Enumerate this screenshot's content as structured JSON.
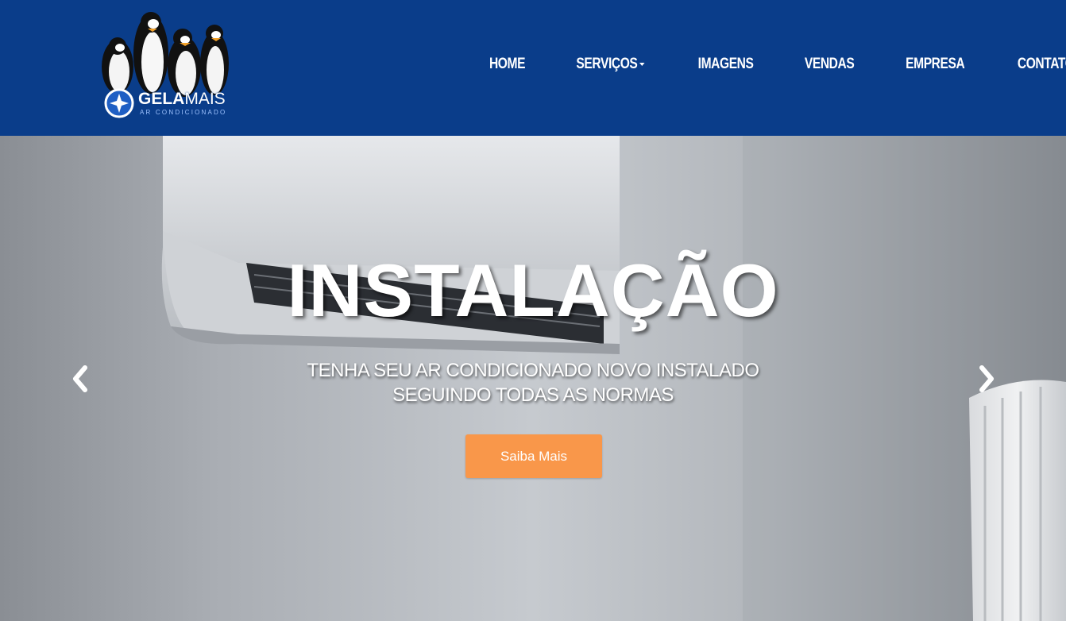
{
  "brand": {
    "name_bold": "GELA",
    "name_light": "MAIS",
    "tagline": "AR CONDICIONADO",
    "logo_icon": "penguins-logo-icon"
  },
  "nav": {
    "items": [
      {
        "label": "HOME",
        "dropdown": false
      },
      {
        "label": "SERVIÇOS",
        "dropdown": true
      },
      {
        "label": "IMAGENS",
        "dropdown": false
      },
      {
        "label": "VENDAS",
        "dropdown": false
      },
      {
        "label": "EMPRESA",
        "dropdown": false
      },
      {
        "label": "CONTATO",
        "dropdown": false
      }
    ]
  },
  "hero": {
    "title": "INSTALAÇÃO",
    "subtitle_line1": "TENHA SEU AR CONDICIONADO NOVO INSTALADO",
    "subtitle_line2": "SEGUINDO TODAS AS NORMAS",
    "cta_label": "Saiba Mais",
    "prev_icon": "chevron-left-icon",
    "next_icon": "chevron-right-icon"
  },
  "colors": {
    "navbar": "#0a3d8a",
    "cta": "#f9974a",
    "text": "#ffffff"
  }
}
